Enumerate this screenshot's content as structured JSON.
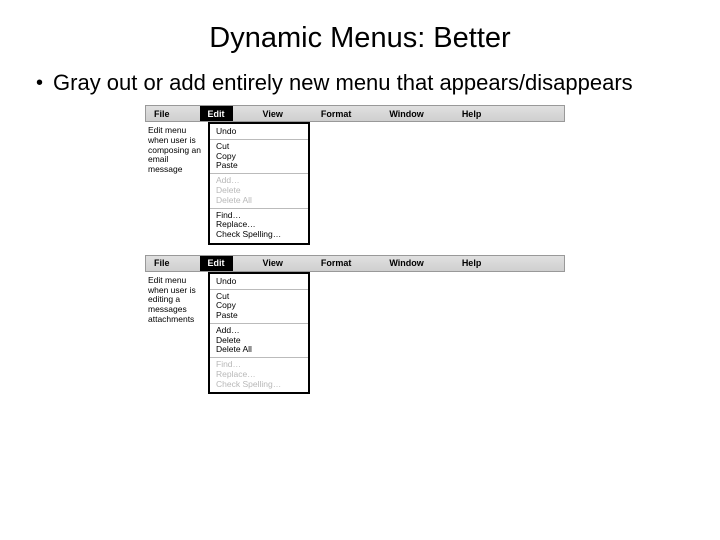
{
  "title": "Dynamic Menus:  Better",
  "bullet": "Gray out or add entirely new menu that appears/disappears",
  "menubar": {
    "file": "File",
    "edit": "Edit",
    "view": "View",
    "format": "Format",
    "window": "Window",
    "help": "Help"
  },
  "example1": {
    "caption": "Edit menu when user is composing an email message",
    "menu": {
      "undo": "Undo",
      "cut": "Cut",
      "copy": "Copy",
      "paste": "Paste",
      "add": "Add…",
      "delete": "Delete",
      "deleteAll": "Delete All",
      "find": "Find…",
      "replace": "Replace…",
      "checkSpelling": "Check Spelling…"
    },
    "disabled": [
      "add",
      "delete",
      "deleteAll"
    ]
  },
  "example2": {
    "caption": "Edit menu when user is editing a messages attachments",
    "menu": {
      "undo": "Undo",
      "cut": "Cut",
      "copy": "Copy",
      "paste": "Paste",
      "add": "Add…",
      "delete": "Delete",
      "deleteAll": "Delete All",
      "find": "Find…",
      "replace": "Replace…",
      "checkSpelling": "Check Spelling…"
    },
    "disabled": [
      "find",
      "replace",
      "checkSpelling"
    ]
  }
}
